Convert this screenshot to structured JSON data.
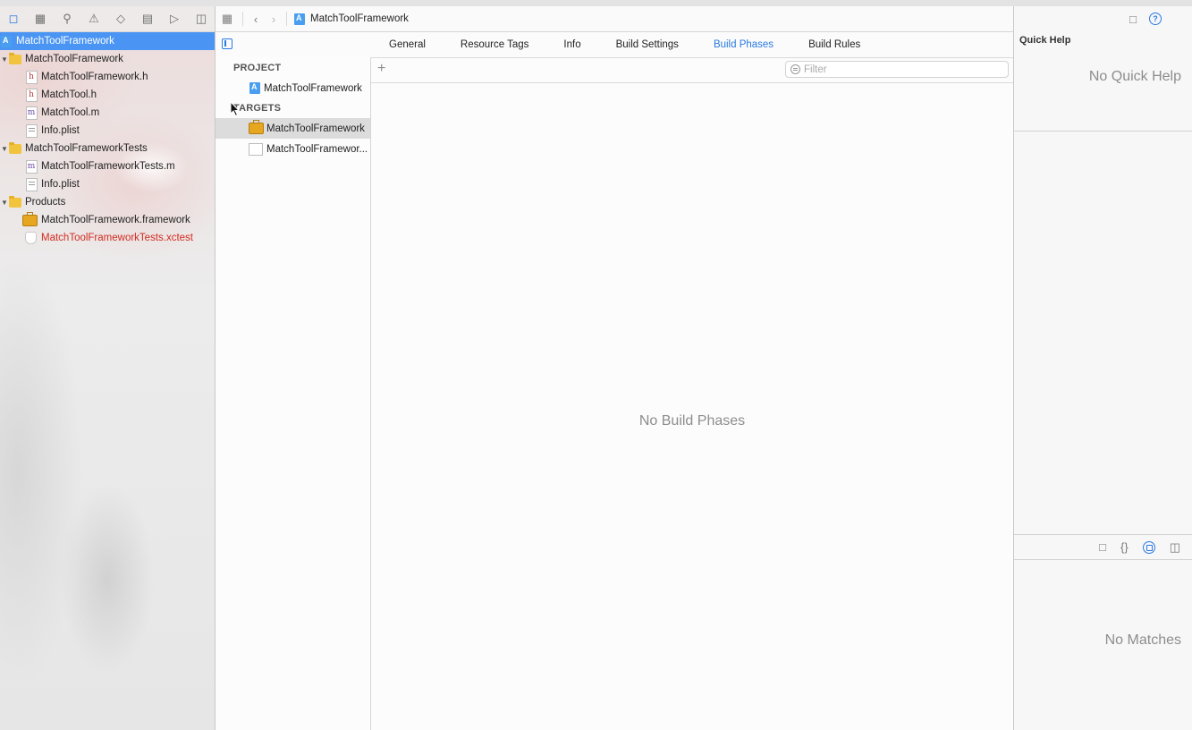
{
  "navigator": {
    "toolbar_icons": [
      "folder-icon",
      "hierarchy-icon",
      "search-icon",
      "warning-icon",
      "test-diamond-icon",
      "debug-icon",
      "breakpoint-icon",
      "report-icon"
    ],
    "items": [
      {
        "label": "MatchToolFramework",
        "icon": "project-icon",
        "level": 0,
        "disclosure": "",
        "selected": true
      },
      {
        "label": "MatchToolFramework",
        "icon": "folder-icon",
        "level": 0,
        "disclosure": "open"
      },
      {
        "label": "MatchToolFramework.h",
        "icon": "header-file-icon",
        "level": 1
      },
      {
        "label": "MatchTool.h",
        "icon": "header-file-icon",
        "level": 1
      },
      {
        "label": "MatchTool.m",
        "icon": "objc-file-icon",
        "level": 1
      },
      {
        "label": "Info.plist",
        "icon": "plist-file-icon",
        "level": 1
      },
      {
        "label": "MatchToolFrameworkTests",
        "icon": "folder-icon",
        "level": 0,
        "disclosure": "open"
      },
      {
        "label": "MatchToolFrameworkTests.m",
        "icon": "objc-file-icon",
        "level": 1
      },
      {
        "label": "Info.plist",
        "icon": "plist-file-icon",
        "level": 1
      },
      {
        "label": "Products",
        "icon": "folder-icon",
        "level": 0,
        "disclosure": "open"
      },
      {
        "label": "MatchToolFramework.framework",
        "icon": "framework-icon",
        "level": 1
      },
      {
        "label": "MatchToolFrameworkTests.xctest",
        "icon": "xctest-icon",
        "level": 1,
        "missing": true
      }
    ]
  },
  "jumpbar": {
    "crumb": "MatchToolFramework"
  },
  "tabs": [
    {
      "label": "General"
    },
    {
      "label": "Resource Tags"
    },
    {
      "label": "Info"
    },
    {
      "label": "Build Settings"
    },
    {
      "label": "Build Phases",
      "active": true
    },
    {
      "label": "Build Rules"
    }
  ],
  "targets_panel": {
    "project_header": "PROJECT",
    "project_item": "MatchToolFramework",
    "targets_header": "TARGETS",
    "targets": [
      {
        "label": "MatchToolFramework",
        "selected": true
      },
      {
        "label": "MatchToolFramewor..."
      }
    ]
  },
  "phases": {
    "add_label": "+",
    "filter_placeholder": "Filter",
    "empty_message": "No Build Phases"
  },
  "inspector": {
    "title": "Quick Help",
    "empty_message": "No Quick Help",
    "library_empty_message": "No Matches"
  },
  "colors": {
    "accent": "#2a7ae2",
    "selection": "#4a95f3",
    "missing_file": "#d22c20"
  }
}
